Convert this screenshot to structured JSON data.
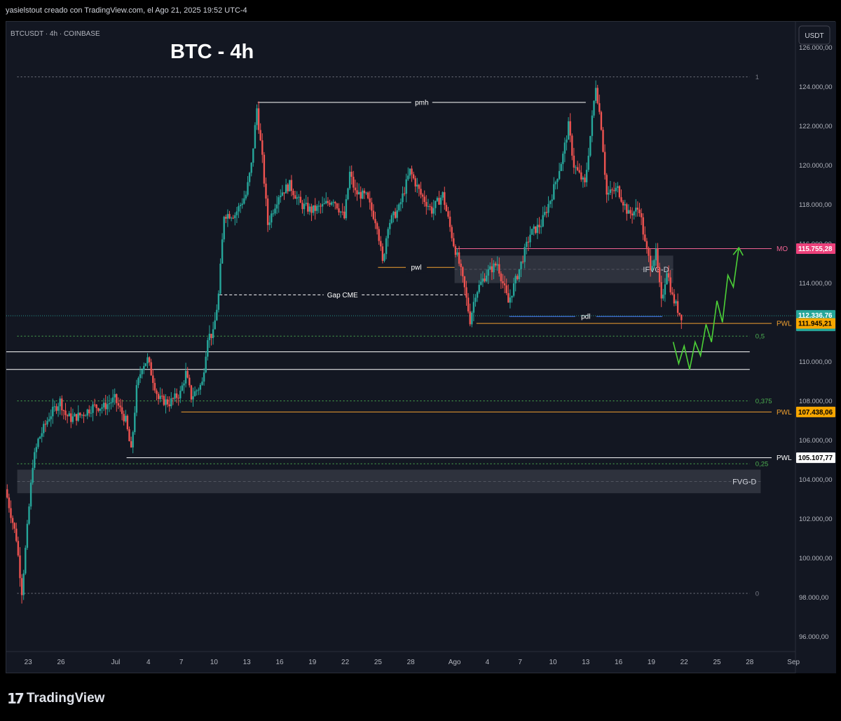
{
  "header": {
    "caption": "yasielstout creado con TradingView.com, el Ago 21, 2025 19:52 UTC-4"
  },
  "symbol_info": "BTCUSDT · 4h · COINBASE",
  "footer": {
    "brand": "TradingView",
    "logo_icon": "tradingview-logo-icon"
  },
  "chart_data": {
    "type": "candlestick",
    "title": "BTC - 4h",
    "currency": "USDT",
    "ylim": [
      95000,
      127000
    ],
    "y_ticks": [
      96000,
      98000,
      100000,
      102000,
      104000,
      106000,
      108000,
      110000,
      112000,
      114000,
      116000,
      118000,
      120000,
      122000,
      124000,
      126000
    ],
    "y_tick_labels": [
      "96.000,00",
      "98.000,00",
      "100.000,00",
      "102.000,00",
      "104.000,00",
      "106.000,00",
      "108.000,00",
      "110.000,00",
      "112.000,00",
      "114.000,00",
      "116.000,00",
      "118.000,00",
      "120.000,00",
      "122.000,00",
      "124.000,00",
      "126.000,00"
    ],
    "x_range": [
      "2025-06-21",
      "2025-09-02"
    ],
    "x_ticks": [
      {
        "date": "2025-06-23",
        "label": "23"
      },
      {
        "date": "2025-06-26",
        "label": "26"
      },
      {
        "date": "2025-07-01",
        "label": "Jul"
      },
      {
        "date": "2025-07-04",
        "label": "4"
      },
      {
        "date": "2025-07-07",
        "label": "7"
      },
      {
        "date": "2025-07-10",
        "label": "10"
      },
      {
        "date": "2025-07-13",
        "label": "13"
      },
      {
        "date": "2025-07-16",
        "label": "16"
      },
      {
        "date": "2025-07-19",
        "label": "19"
      },
      {
        "date": "2025-07-22",
        "label": "22"
      },
      {
        "date": "2025-07-25",
        "label": "25"
      },
      {
        "date": "2025-07-28",
        "label": "28"
      },
      {
        "date": "2025-08-01",
        "label": "Ago"
      },
      {
        "date": "2025-08-04",
        "label": "4"
      },
      {
        "date": "2025-08-07",
        "label": "7"
      },
      {
        "date": "2025-08-10",
        "label": "10"
      },
      {
        "date": "2025-08-13",
        "label": "13"
      },
      {
        "date": "2025-08-16",
        "label": "16"
      },
      {
        "date": "2025-08-19",
        "label": "19"
      },
      {
        "date": "2025-08-22",
        "label": "22"
      },
      {
        "date": "2025-08-25",
        "label": "25"
      },
      {
        "date": "2025-08-28",
        "label": "28"
      },
      {
        "date": "2025-09-01",
        "label": "Sep"
      }
    ],
    "colors": {
      "up": "#26a69a",
      "down": "#ef5350",
      "background": "#131722",
      "axis_text": "#b2b5be",
      "grid": "#2a2e39"
    },
    "price_path": [
      [
        "2025-06-21",
        103500
      ],
      [
        "2025-06-22",
        101000
      ],
      [
        "2025-06-22 12:00",
        98300
      ],
      [
        "2025-06-23",
        101500
      ],
      [
        "2025-06-23 12:00",
        104800
      ],
      [
        "2025-06-24",
        106000
      ],
      [
        "2025-06-25",
        107200
      ],
      [
        "2025-06-26",
        108000
      ],
      [
        "2025-06-26 12:00",
        107300
      ],
      [
        "2025-06-27",
        107100
      ],
      [
        "2025-06-28",
        107300
      ],
      [
        "2025-06-29",
        107700
      ],
      [
        "2025-06-30",
        107700
      ],
      [
        "2025-07-01",
        108100
      ],
      [
        "2025-07-02",
        107000
      ],
      [
        "2025-07-02 12:00",
        105400
      ],
      [
        "2025-07-03",
        108600
      ],
      [
        "2025-07-03 12:00",
        109800
      ],
      [
        "2025-07-04",
        110100
      ],
      [
        "2025-07-05",
        108100
      ],
      [
        "2025-07-06",
        107900
      ],
      [
        "2025-07-07",
        108400
      ],
      [
        "2025-07-07 12:00",
        109400
      ],
      [
        "2025-07-08",
        108200
      ],
      [
        "2025-07-09",
        108900
      ],
      [
        "2025-07-09 12:00",
        111300
      ],
      [
        "2025-07-10",
        111400
      ],
      [
        "2025-07-10 12:00",
        113400
      ],
      [
        "2025-07-11",
        117500
      ],
      [
        "2025-07-12",
        117500
      ],
      [
        "2025-07-13",
        118500
      ],
      [
        "2025-07-13 12:00",
        120000
      ],
      [
        "2025-07-14",
        122900
      ],
      [
        "2025-07-14 12:00",
        120300
      ],
      [
        "2025-07-15",
        117000
      ],
      [
        "2025-07-16",
        118500
      ],
      [
        "2025-07-17",
        119000
      ],
      [
        "2025-07-18",
        118000
      ],
      [
        "2025-07-19",
        117700
      ],
      [
        "2025-07-20",
        117900
      ],
      [
        "2025-07-21",
        118300
      ],
      [
        "2025-07-22",
        117300
      ],
      [
        "2025-07-22 12:00",
        119600
      ],
      [
        "2025-07-23",
        118600
      ],
      [
        "2025-07-24",
        118400
      ],
      [
        "2025-07-25",
        117000
      ],
      [
        "2025-07-25 12:00",
        115000
      ],
      [
        "2025-07-26",
        117000
      ],
      [
        "2025-07-27",
        117800
      ],
      [
        "2025-07-28",
        119700
      ],
      [
        "2025-07-29",
        118500
      ],
      [
        "2025-07-30",
        117700
      ],
      [
        "2025-07-31",
        118500
      ],
      [
        "2025-08-01",
        116000
      ],
      [
        "2025-08-01 12:00",
        115000
      ],
      [
        "2025-08-02",
        113700
      ],
      [
        "2025-08-02 12:00",
        112100
      ],
      [
        "2025-08-03",
        113500
      ],
      [
        "2025-08-04",
        114500
      ],
      [
        "2025-08-05",
        115000
      ],
      [
        "2025-08-05 12:00",
        114000
      ],
      [
        "2025-08-06",
        113000
      ],
      [
        "2025-08-07",
        114700
      ],
      [
        "2025-08-08",
        116500
      ],
      [
        "2025-08-09",
        117000
      ],
      [
        "2025-08-10",
        118500
      ],
      [
        "2025-08-11",
        120500
      ],
      [
        "2025-08-11 12:00",
        122000
      ],
      [
        "2025-08-12",
        120000
      ],
      [
        "2025-08-13",
        119000
      ],
      [
        "2025-08-13 12:00",
        121500
      ],
      [
        "2025-08-14",
        124100
      ],
      [
        "2025-08-14 12:00",
        122000
      ],
      [
        "2025-08-15",
        118500
      ],
      [
        "2025-08-16",
        118800
      ],
      [
        "2025-08-17",
        117500
      ],
      [
        "2025-08-18",
        117800
      ],
      [
        "2025-08-18 12:00",
        116000
      ],
      [
        "2025-08-19",
        114900
      ],
      [
        "2025-08-19 12:00",
        115500
      ],
      [
        "2025-08-20",
        113000
      ],
      [
        "2025-08-20 12:00",
        114700
      ],
      [
        "2025-08-21",
        113300
      ],
      [
        "2025-08-21 18:00",
        112337
      ]
    ],
    "horizontal_levels": [
      {
        "name": "fib-1",
        "price": 124500,
        "label": "1",
        "style": "dotted",
        "color": "#787b86",
        "from": "2025-06-22",
        "to": "2025-08-28"
      },
      {
        "name": "fib-0.5",
        "price": 111300,
        "label": "0,5",
        "style": "dotted",
        "color": "#4caf50",
        "from": "2025-06-22",
        "to": "2025-08-28"
      },
      {
        "name": "fib-0.375",
        "price": 108000,
        "label": "0,375",
        "style": "dotted",
        "color": "#4caf50",
        "from": "2025-06-22",
        "to": "2025-08-28"
      },
      {
        "name": "fib-0.25",
        "price": 104800,
        "label": "0,25",
        "style": "dotted",
        "color": "#4caf50",
        "from": "2025-06-22",
        "to": "2025-08-28"
      },
      {
        "name": "fib-0",
        "price": 98200,
        "label": "0",
        "style": "dotted",
        "color": "#787b86",
        "from": "2025-06-22",
        "to": "2025-08-28"
      },
      {
        "name": "pmh",
        "price": 123200,
        "label": "pmh",
        "style": "solid",
        "color": "#ffffff",
        "from": "2025-07-14",
        "to": "2025-08-13"
      },
      {
        "name": "pwl-upper",
        "price": 114800,
        "label": "pwl",
        "style": "solid",
        "color": "#f0a030",
        "from": "2025-07-25",
        "to": "2025-08-01"
      },
      {
        "name": "gap-cme",
        "price": 113400,
        "label": "Gap CME",
        "style": "dashed",
        "color": "#ffffff",
        "from": "2025-07-10 12:00",
        "to": "2025-08-02"
      },
      {
        "name": "pdl",
        "price": 112300,
        "label": "pdl",
        "style": "solid",
        "color": "#4a7bf7",
        "from": "2025-08-06",
        "to": "2025-08-20"
      },
      {
        "name": "mo",
        "price": 115755.28,
        "label": "MO",
        "style": "solid",
        "color": "#f06292",
        "from": "2025-08-01",
        "to": "2025-08-30"
      },
      {
        "name": "pwl-112",
        "price": 111945.21,
        "label": "PWL",
        "style": "solid",
        "color": "#f0a030",
        "from": "2025-08-03",
        "to": "2025-08-30"
      },
      {
        "name": "pwl-107",
        "price": 107438.06,
        "label": "PWL",
        "style": "solid",
        "color": "#f0a030",
        "from": "2025-07-07",
        "to": "2025-08-30"
      },
      {
        "name": "pwl-105",
        "price": 105107.77,
        "label": "PWL",
        "style": "solid",
        "color": "#ffffff",
        "from": "2025-07-02",
        "to": "2025-08-30"
      },
      {
        "name": "white-line-110.5",
        "price": 110500,
        "label": "",
        "style": "solid",
        "color": "#ffffff",
        "from": "2025-06-21",
        "to": "2025-08-28"
      },
      {
        "name": "white-line-109.6",
        "price": 109600,
        "label": "",
        "style": "solid",
        "color": "#ffffff",
        "from": "2025-06-21",
        "to": "2025-08-28"
      }
    ],
    "zones": [
      {
        "name": "ifvg-d",
        "label": "IFVG-D",
        "top": 115400,
        "bottom": 114000,
        "from": "2025-08-01",
        "to": "2025-08-21"
      },
      {
        "name": "fvg-d",
        "label": "FVG-D",
        "top": 104500,
        "bottom": 103300,
        "from": "2025-06-22",
        "to": "2025-08-29"
      }
    ],
    "price_badges": [
      {
        "name": "mo-badge",
        "label": "115.755,28",
        "price": 115755.28,
        "bg": "#ec407a",
        "fg": "#ffffff"
      },
      {
        "name": "current-badge",
        "label": "112.336,76",
        "sublabel": "07:16",
        "price": 112336.76,
        "bg": "#26a69a",
        "fg": "#ffffff"
      },
      {
        "name": "pwl-112-badge",
        "label": "111.945,21",
        "price": 111945.21,
        "bg": "#f7a600",
        "fg": "#000000"
      },
      {
        "name": "pwl-107-badge",
        "label": "107.438,06",
        "price": 107438.06,
        "bg": "#f7a600",
        "fg": "#000000"
      },
      {
        "name": "pwl-105-badge",
        "label": "105.107,77",
        "price": 105107.77,
        "bg": "#ffffff",
        "fg": "#000000"
      }
    ],
    "projection": {
      "color": "#4cd137",
      "points": [
        [
          "2025-08-21",
          111000
        ],
        [
          "2025-08-21 12:00",
          109900
        ],
        [
          "2025-08-22",
          110800
        ],
        [
          "2025-08-22 12:00",
          109600
        ],
        [
          "2025-08-23",
          111000
        ],
        [
          "2025-08-23 12:00",
          110300
        ],
        [
          "2025-08-24",
          111900
        ],
        [
          "2025-08-24 12:00",
          111000
        ],
        [
          "2025-08-25",
          113100
        ],
        [
          "2025-08-25 12:00",
          112000
        ],
        [
          "2025-08-26",
          114400
        ],
        [
          "2025-08-26 12:00",
          113800
        ],
        [
          "2025-08-27",
          115800
        ]
      ]
    }
  }
}
